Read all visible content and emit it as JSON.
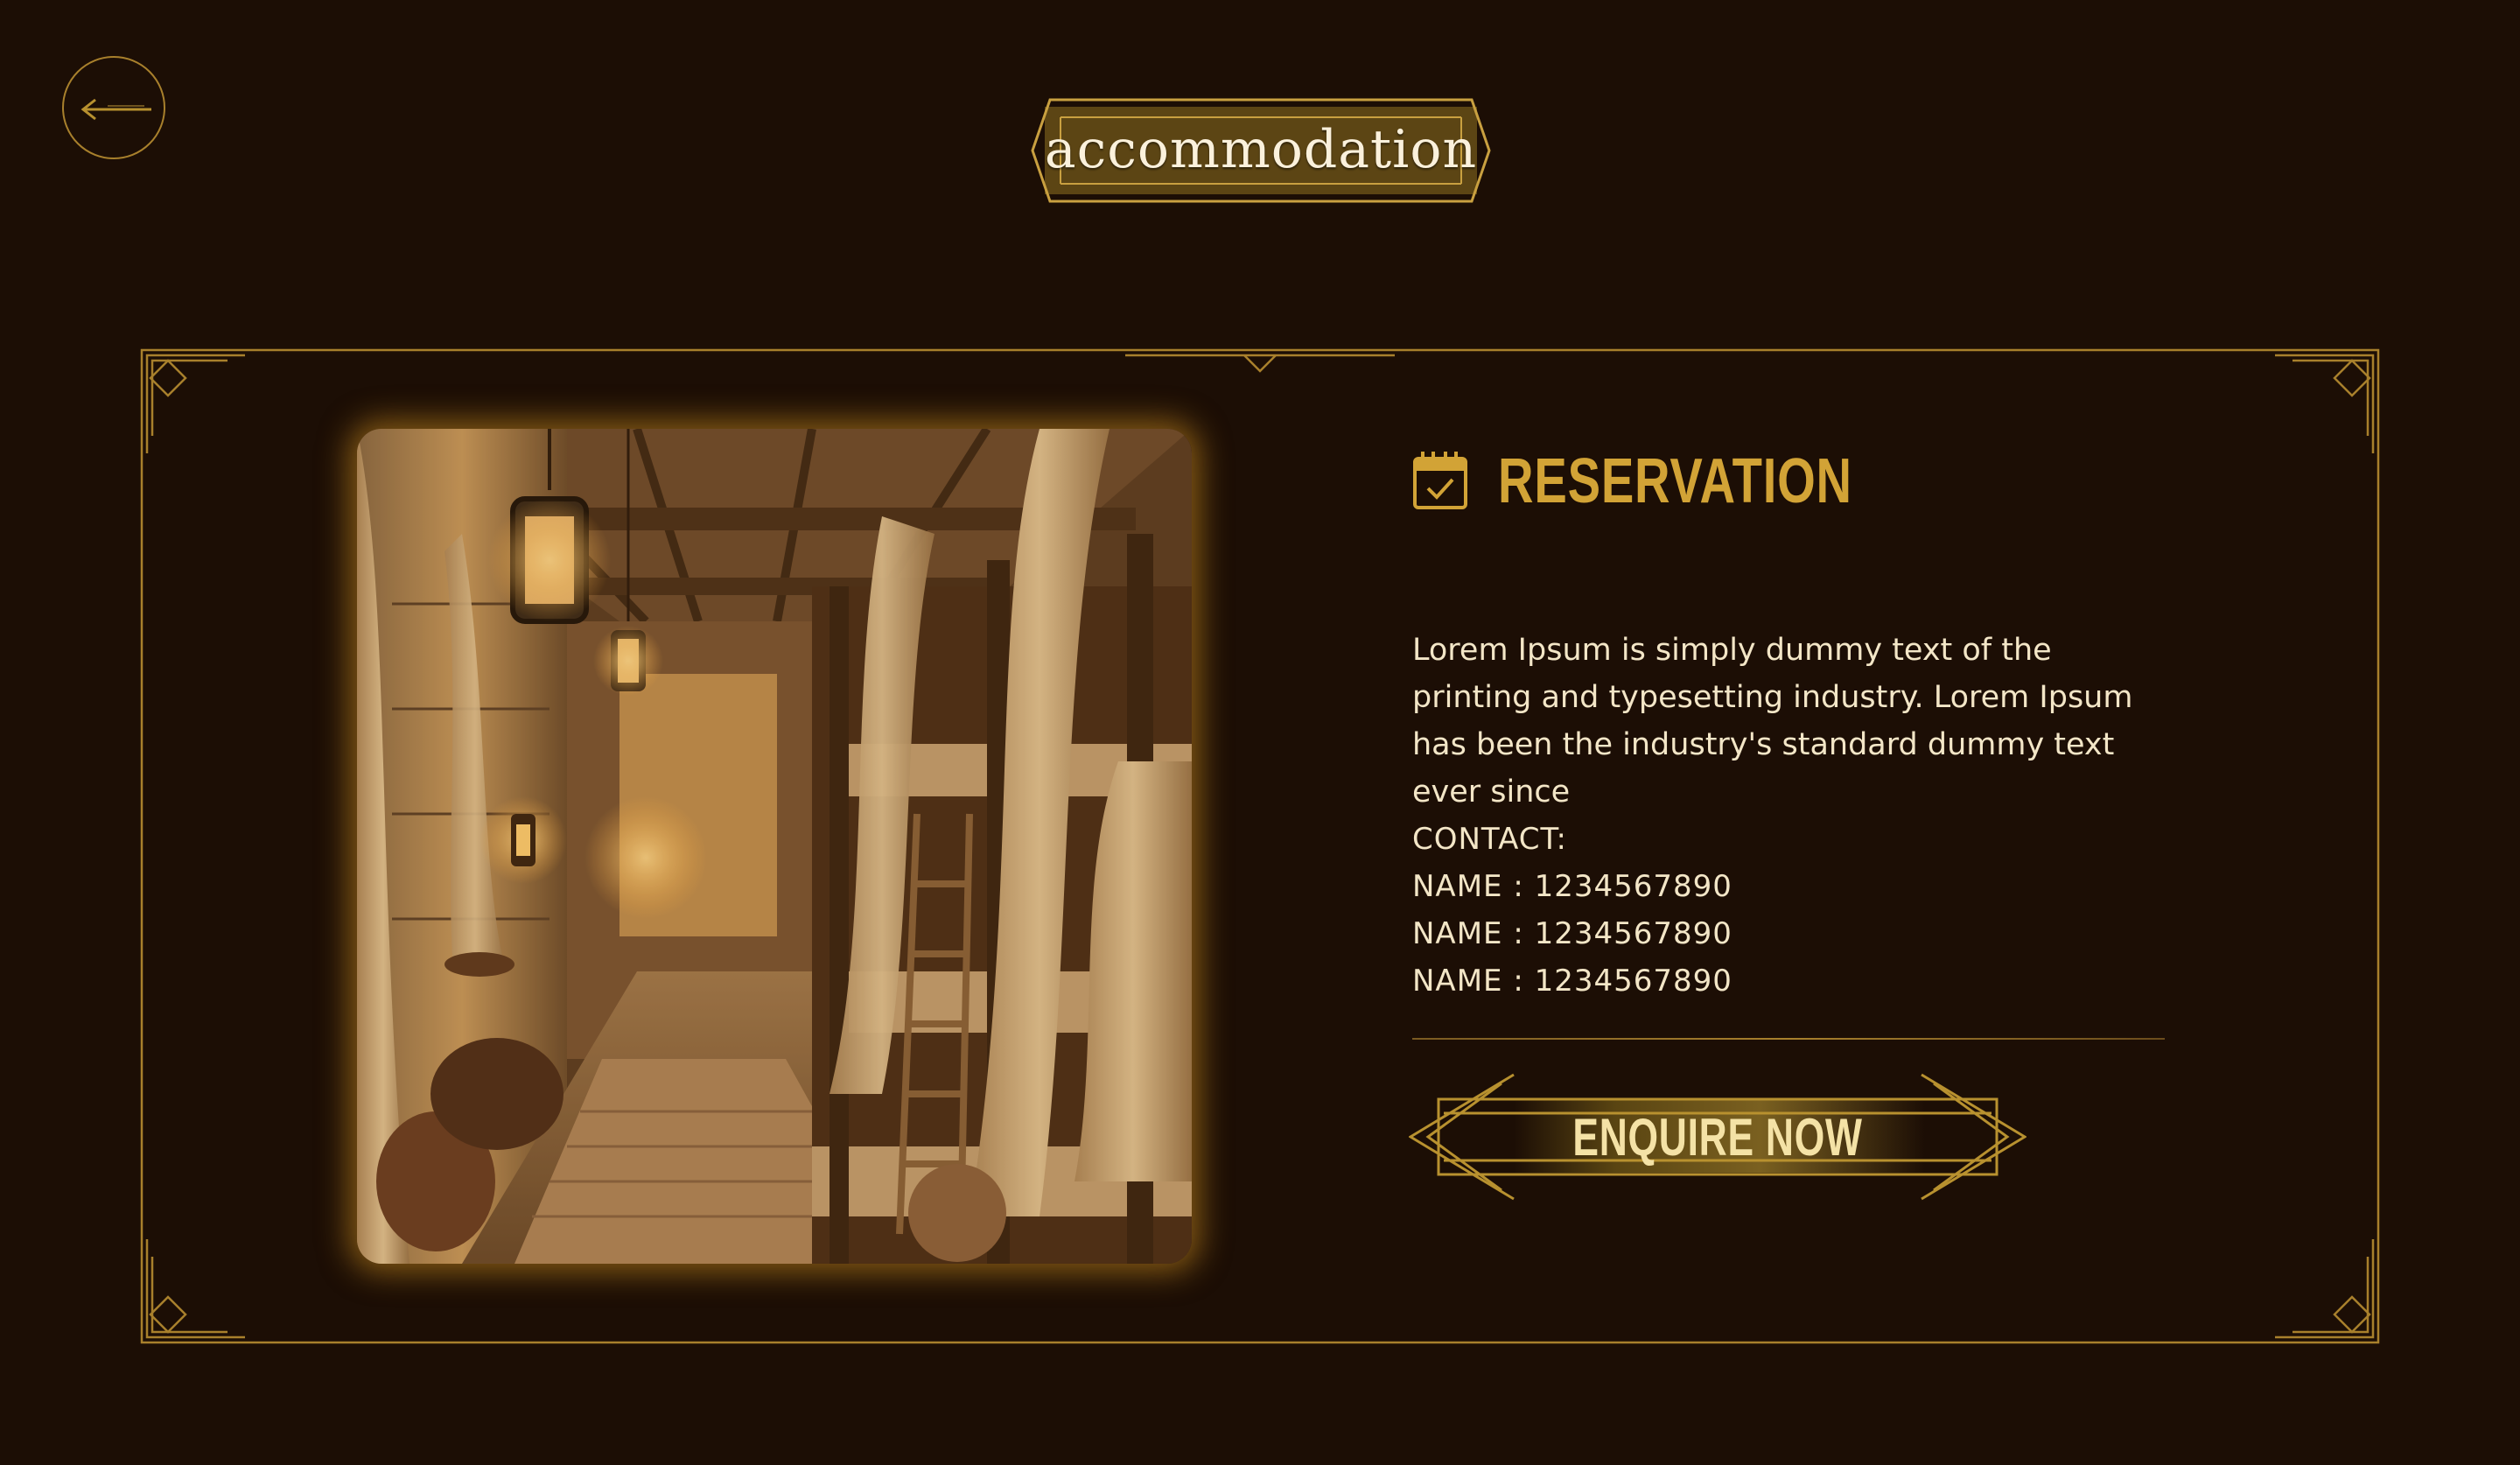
{
  "header": {
    "back_icon": "arrow-left-icon",
    "title": "accommodation"
  },
  "reservation": {
    "icon": "calendar-check-icon",
    "heading": "RESERVATION",
    "description": "Lorem Ipsum is simply dummy text of the printing and typesetting industry. Lorem Ipsum has been the industry's standard dummy text ever since",
    "contact_label": "CONTACT:",
    "contacts": [
      "NAME : 1234567890",
      "NAME : 1234567890",
      "NAME : 1234567890"
    ],
    "button_label": "ENQUIRE NOW"
  },
  "colors": {
    "background": "#1c0e05",
    "gold": "#b8912f",
    "heading_gold": "#d2a336",
    "text": "#f3e6c7"
  }
}
